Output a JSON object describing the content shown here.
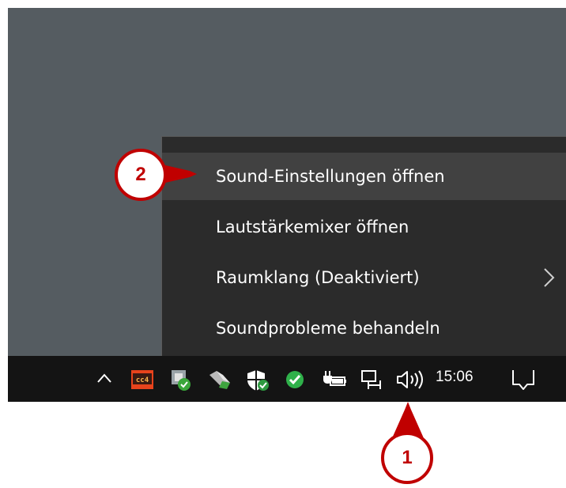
{
  "context_menu": {
    "items": [
      {
        "label": "Sound-Einstellungen öffnen"
      },
      {
        "label": "Lautstärkemixer öffnen"
      },
      {
        "label": "Raumklang (Deaktiviert)"
      },
      {
        "label": "Soundprobleme behandeln"
      }
    ]
  },
  "taskbar": {
    "clock": "15:06",
    "tray_icons": [
      "chevron-up-icon",
      "cc4-app-icon",
      "sync-check-icon",
      "usb-device-icon",
      "defender-shield-icon",
      "checkmark-icon",
      "battery-plug-icon",
      "network-icon",
      "speaker-icon",
      "action-center-icon"
    ],
    "cc4_label": "cc4"
  },
  "callouts": {
    "one": "1",
    "two": "2"
  },
  "colors": {
    "desktop": "#555c61",
    "taskbar": "#141414",
    "menu": "#2b2b2b",
    "menu_hover": "#414141",
    "callout_red": "#c00000"
  }
}
